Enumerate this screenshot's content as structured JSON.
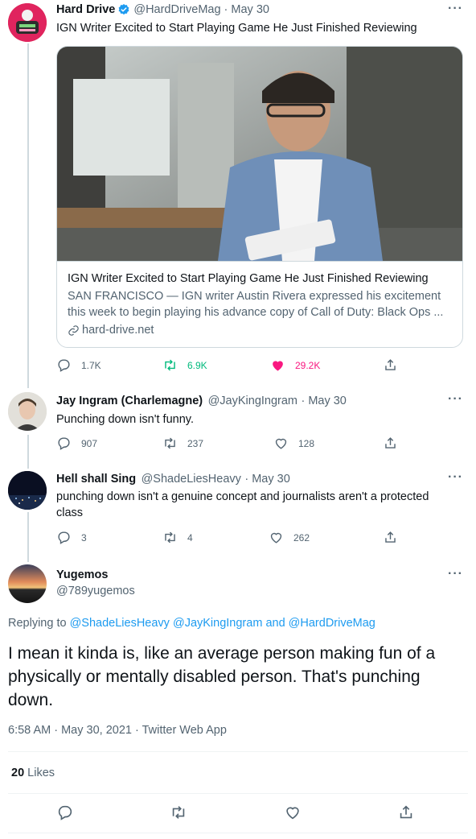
{
  "tweets": [
    {
      "name": "Hard Drive",
      "handle": "@HardDriveMag",
      "date": "· May 30",
      "text": "IGN Writer Excited to Start Playing Game He Just Finished Reviewing",
      "card": {
        "title": "IGN Writer Excited to Start Playing Game He Just Finished Reviewing",
        "description": "SAN FRANCISCO — IGN writer Austin Rivera expressed his excitement this week to begin playing his advance copy of Call of Duty: Black Ops ...",
        "domain": "hard-drive.net"
      },
      "replies": "1.7K",
      "retweets": "6.9K",
      "likes": "29.2K"
    },
    {
      "name": "Jay Ingram (Charlemagne)",
      "handle": "@JayKingIngram",
      "date": "· May 30",
      "text": "Punching down isn't funny.",
      "replies": "907",
      "retweets": "237",
      "likes": "128"
    },
    {
      "name": "Hell shall Sing",
      "handle": "@ShadeLiesHeavy",
      "date": "· May 30",
      "text": "punching down isn't a genuine concept and journalists aren't a protected class",
      "replies": "3",
      "retweets": "4",
      "likes": "262"
    }
  ],
  "focus": {
    "name": "Yugemos",
    "handle": "@789yugemos",
    "replying_to": "Replying to",
    "reply_user1": "@ShadeLiesHeavy",
    "reply_user2": "@JayKingIngram",
    "reply_and": "and",
    "reply_user3": "@HardDriveMag",
    "text": "I mean it kinda is, like an average person making fun of a physically or mentally disabled person. That's punching down.",
    "timestamp": "6:58 AM · May 30, 2021 · Twitter Web App",
    "likes_count": "20",
    "likes_label": "Likes"
  },
  "more_label": "···",
  "colors": {
    "accent": "#1d9bf0",
    "retweet": "#00ba7c",
    "like": "#f91880",
    "muted": "#536471"
  }
}
